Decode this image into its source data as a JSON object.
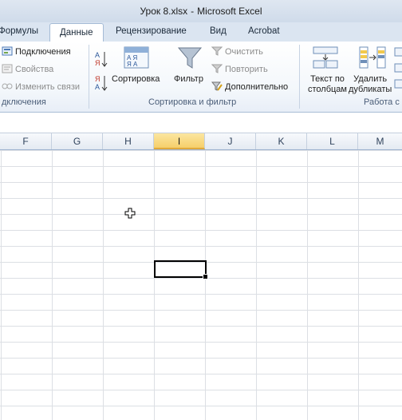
{
  "window": {
    "filename": "Урок 8.xlsx",
    "separator": "-",
    "app_name": "Microsoft Excel"
  },
  "tabs": [
    {
      "label": "Формулы",
      "active": false
    },
    {
      "label": "Данные",
      "active": true
    },
    {
      "label": "Рецензирование",
      "active": false
    },
    {
      "label": "Вид",
      "active": false
    },
    {
      "label": "Acrobat",
      "active": false
    }
  ],
  "ribbon": {
    "connections_group": {
      "label": "дключения",
      "items": [
        {
          "label": "Подключения",
          "icon": "connections-icon",
          "enabled": true
        },
        {
          "label": "Свойства",
          "icon": "properties-icon",
          "enabled": false
        },
        {
          "label": "Изменить связи",
          "icon": "edit-links-icon",
          "enabled": false
        }
      ]
    },
    "sort_filter_group": {
      "label": "Сортировка и фильтр",
      "sort_az_icon": "sort-a-z-icon",
      "sort_za_icon": "sort-z-a-icon",
      "sort_button": "Сортировка",
      "filter_button": "Фильтр",
      "clear": "Очистить",
      "reapply": "Повторить",
      "advanced": "Дополнительно"
    },
    "data_tools_group": {
      "label": "Работа с",
      "text_to_columns_line1": "Текст по",
      "text_to_columns_line2": "столбцам",
      "remove_duplicates_line1": "Удалить",
      "remove_duplicates_line2": "дубликаты"
    }
  },
  "columns": [
    "F",
    "G",
    "H",
    "I",
    "J",
    "K",
    "L",
    "M"
  ],
  "selected_column": "I",
  "colors": {
    "selected_header": "#f6cf6a",
    "accent": "#2b579a"
  }
}
